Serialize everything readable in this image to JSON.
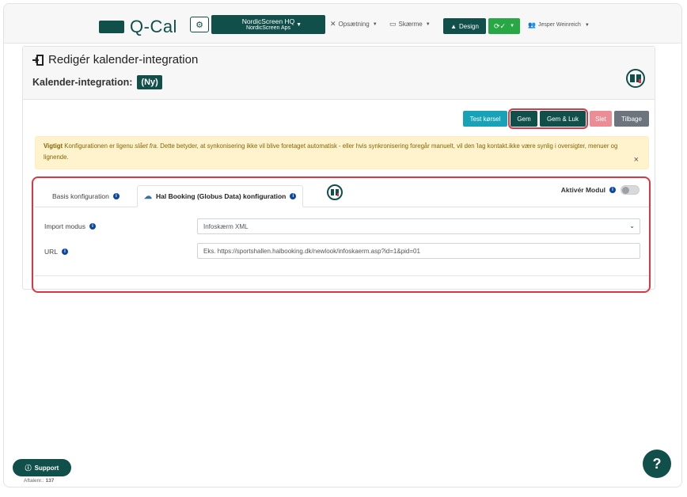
{
  "header": {
    "logo_text": "Q-Cal",
    "org_name": "NordicScreen HQ",
    "org_sub": "NordicScreen Aps",
    "nav": [
      {
        "label": "Opsætning",
        "icon": "wrench-icon"
      },
      {
        "label": "Skærme",
        "icon": "monitor-icon"
      }
    ],
    "design_label": "Design",
    "user_name": "Jesper Weinreich"
  },
  "page": {
    "title": "Redigér kalender-integration",
    "subtitle": "Kalender-integration:",
    "badge": "(Ny)"
  },
  "toolbar": {
    "test_label": "Test kørsel",
    "save_label": "Gem",
    "save_close_label": "Gem & Luk",
    "delete_label": "Slet",
    "back_label": "Tilbage"
  },
  "alert": {
    "strong": "Vigtigt",
    "text1": " Konfigurationen er ligenu ",
    "em": "slået fra",
    "text2": ". Dette betyder, at synkonisering ikke vil blive foretaget automatisk - eller hvis synkronisering foregår manuelt, vil den Ίag kontakt.ikke være synlig i oversigter, menuer og lignende.",
    "close": "×"
  },
  "tabs": {
    "basis_label": "Basis konfiguration",
    "hal_label": "Hal Booking (Globus Data) konfiguration",
    "activate_label": "Aktivér Modul",
    "activate_on": false
  },
  "form": {
    "import_label": "Import modus",
    "import_value": "Infoskærm XML",
    "url_label": "URL",
    "url_placeholder": "Eks. https://sportshallen.halbooking.dk/newlook/infoskaerm.asp?id=1&pid=01"
  },
  "footer": {
    "support_label": "Support",
    "aftalenr_label": "Aftalenr.:",
    "aftalenr_value": "137",
    "help_label": "?"
  },
  "colors": {
    "brand": "#114f4a",
    "success": "#28a745",
    "info": "#17a2b8",
    "danger": "#dc3545",
    "warning_bg": "#fff3cd"
  }
}
